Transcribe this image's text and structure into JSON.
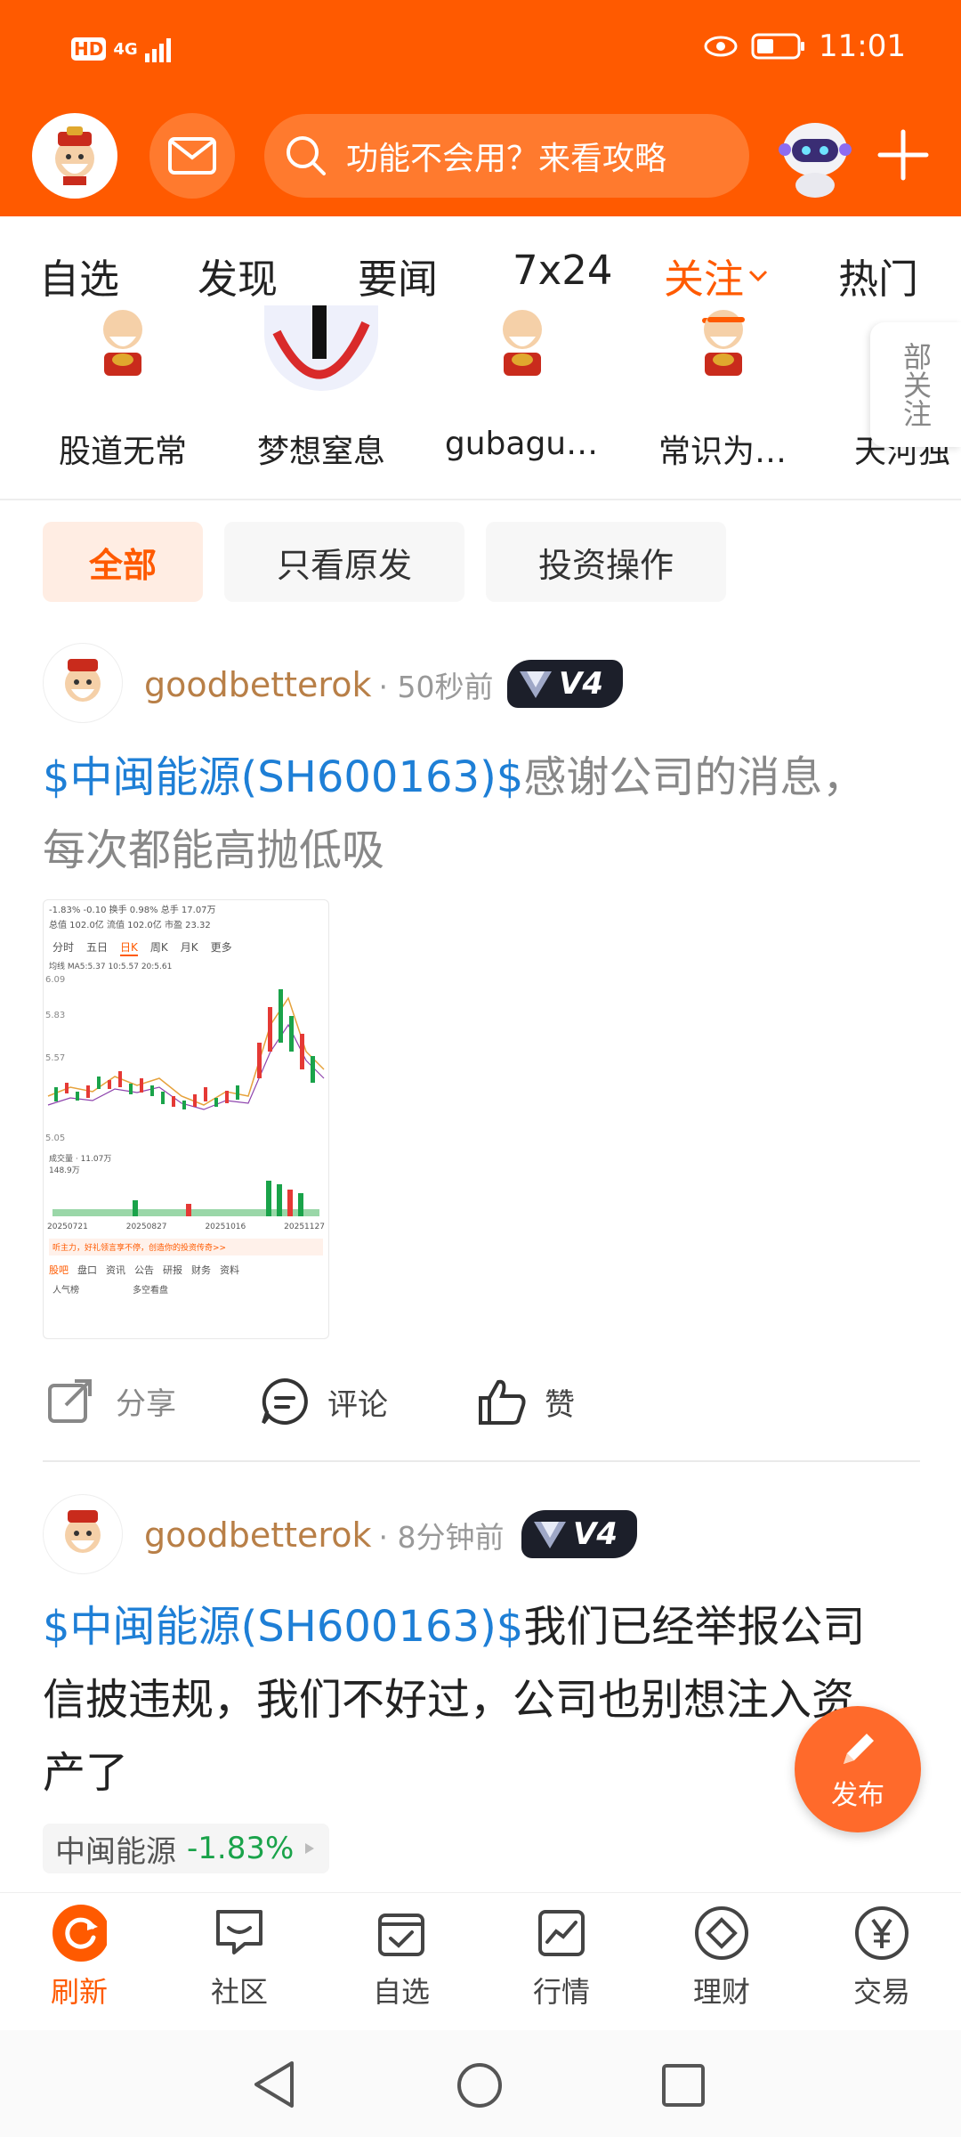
{
  "status": {
    "hd": "HD",
    "signal": "4G",
    "time": "11:01"
  },
  "header": {
    "search_placeholder": "功能不会用？来看攻略"
  },
  "tabs": [
    {
      "label": "自选"
    },
    {
      "label": "发现"
    },
    {
      "label": "要闻"
    },
    {
      "label": "7x24"
    },
    {
      "label": "关注"
    },
    {
      "label": "热门"
    }
  ],
  "following": [
    {
      "name": "股道无常"
    },
    {
      "name": "梦想窒息"
    },
    {
      "name": "gubagu…"
    },
    {
      "name": "常识为…"
    },
    {
      "name": "天河独"
    }
  ],
  "all_following_label": "部关注",
  "filters": [
    {
      "label": "全部"
    },
    {
      "label": "只看原发"
    },
    {
      "label": "投资操作"
    }
  ],
  "posts": [
    {
      "username": "goodbetterok",
      "time": "· 50秒前",
      "badge": "V4",
      "stock": "$中闽能源(SH600163)$",
      "text_line1": "感谢公司的消息，",
      "text_line2": "每次都能高抛低吸"
    },
    {
      "username": "goodbetterok",
      "time": "· 8分钟前",
      "badge": "V4",
      "stock": "$中闽能源(SH600163)$",
      "text_line1": "我们已经举报公司",
      "text_line2": "信披违规，我们不好过，公司也别想注入资",
      "text_line3": "产了",
      "quote_name": "中闽能源",
      "quote_change": "-1.83%"
    }
  ],
  "chart_thumb": {
    "top_line": "-1.83%  -0.10  换手 0.98%  总手 17.07万",
    "stats": "总值 102.0亿  流值 102.0亿  市盈 23.32",
    "tabs": [
      "分时",
      "五日",
      "日K",
      "周K",
      "月K",
      "更多"
    ],
    "ma": "均线  MA5:5.37  10:5.57  20:5.61",
    "y_labels": [
      "6.09",
      "5.83",
      "5.57",
      "5.05"
    ],
    "vol_label": "成交量 · 11.07万",
    "vol_max": "148.9万",
    "dates": [
      "20250721",
      "20250827",
      "20251016",
      "20251127"
    ],
    "promo": "听主力，好礼领言享不停，创造你的投资传奇>>",
    "bottom_tabs": [
      "股吧",
      "盘口",
      "资讯",
      "公告",
      "研报",
      "财务",
      "资料"
    ],
    "bottom_labels": [
      "人气榜",
      "多空看盘"
    ]
  },
  "actions": {
    "share": "分享",
    "comment": "评论",
    "like": "赞"
  },
  "publish_label": "发布",
  "bottom_nav": [
    {
      "label": "刷新"
    },
    {
      "label": "社区"
    },
    {
      "label": "自选"
    },
    {
      "label": "行情"
    },
    {
      "label": "理财"
    },
    {
      "label": "交易"
    }
  ],
  "colors": {
    "brand": "#FF5A00",
    "stock_link": "#1E7FD6",
    "username": "#B87F47",
    "negative": "#1AA34A"
  }
}
